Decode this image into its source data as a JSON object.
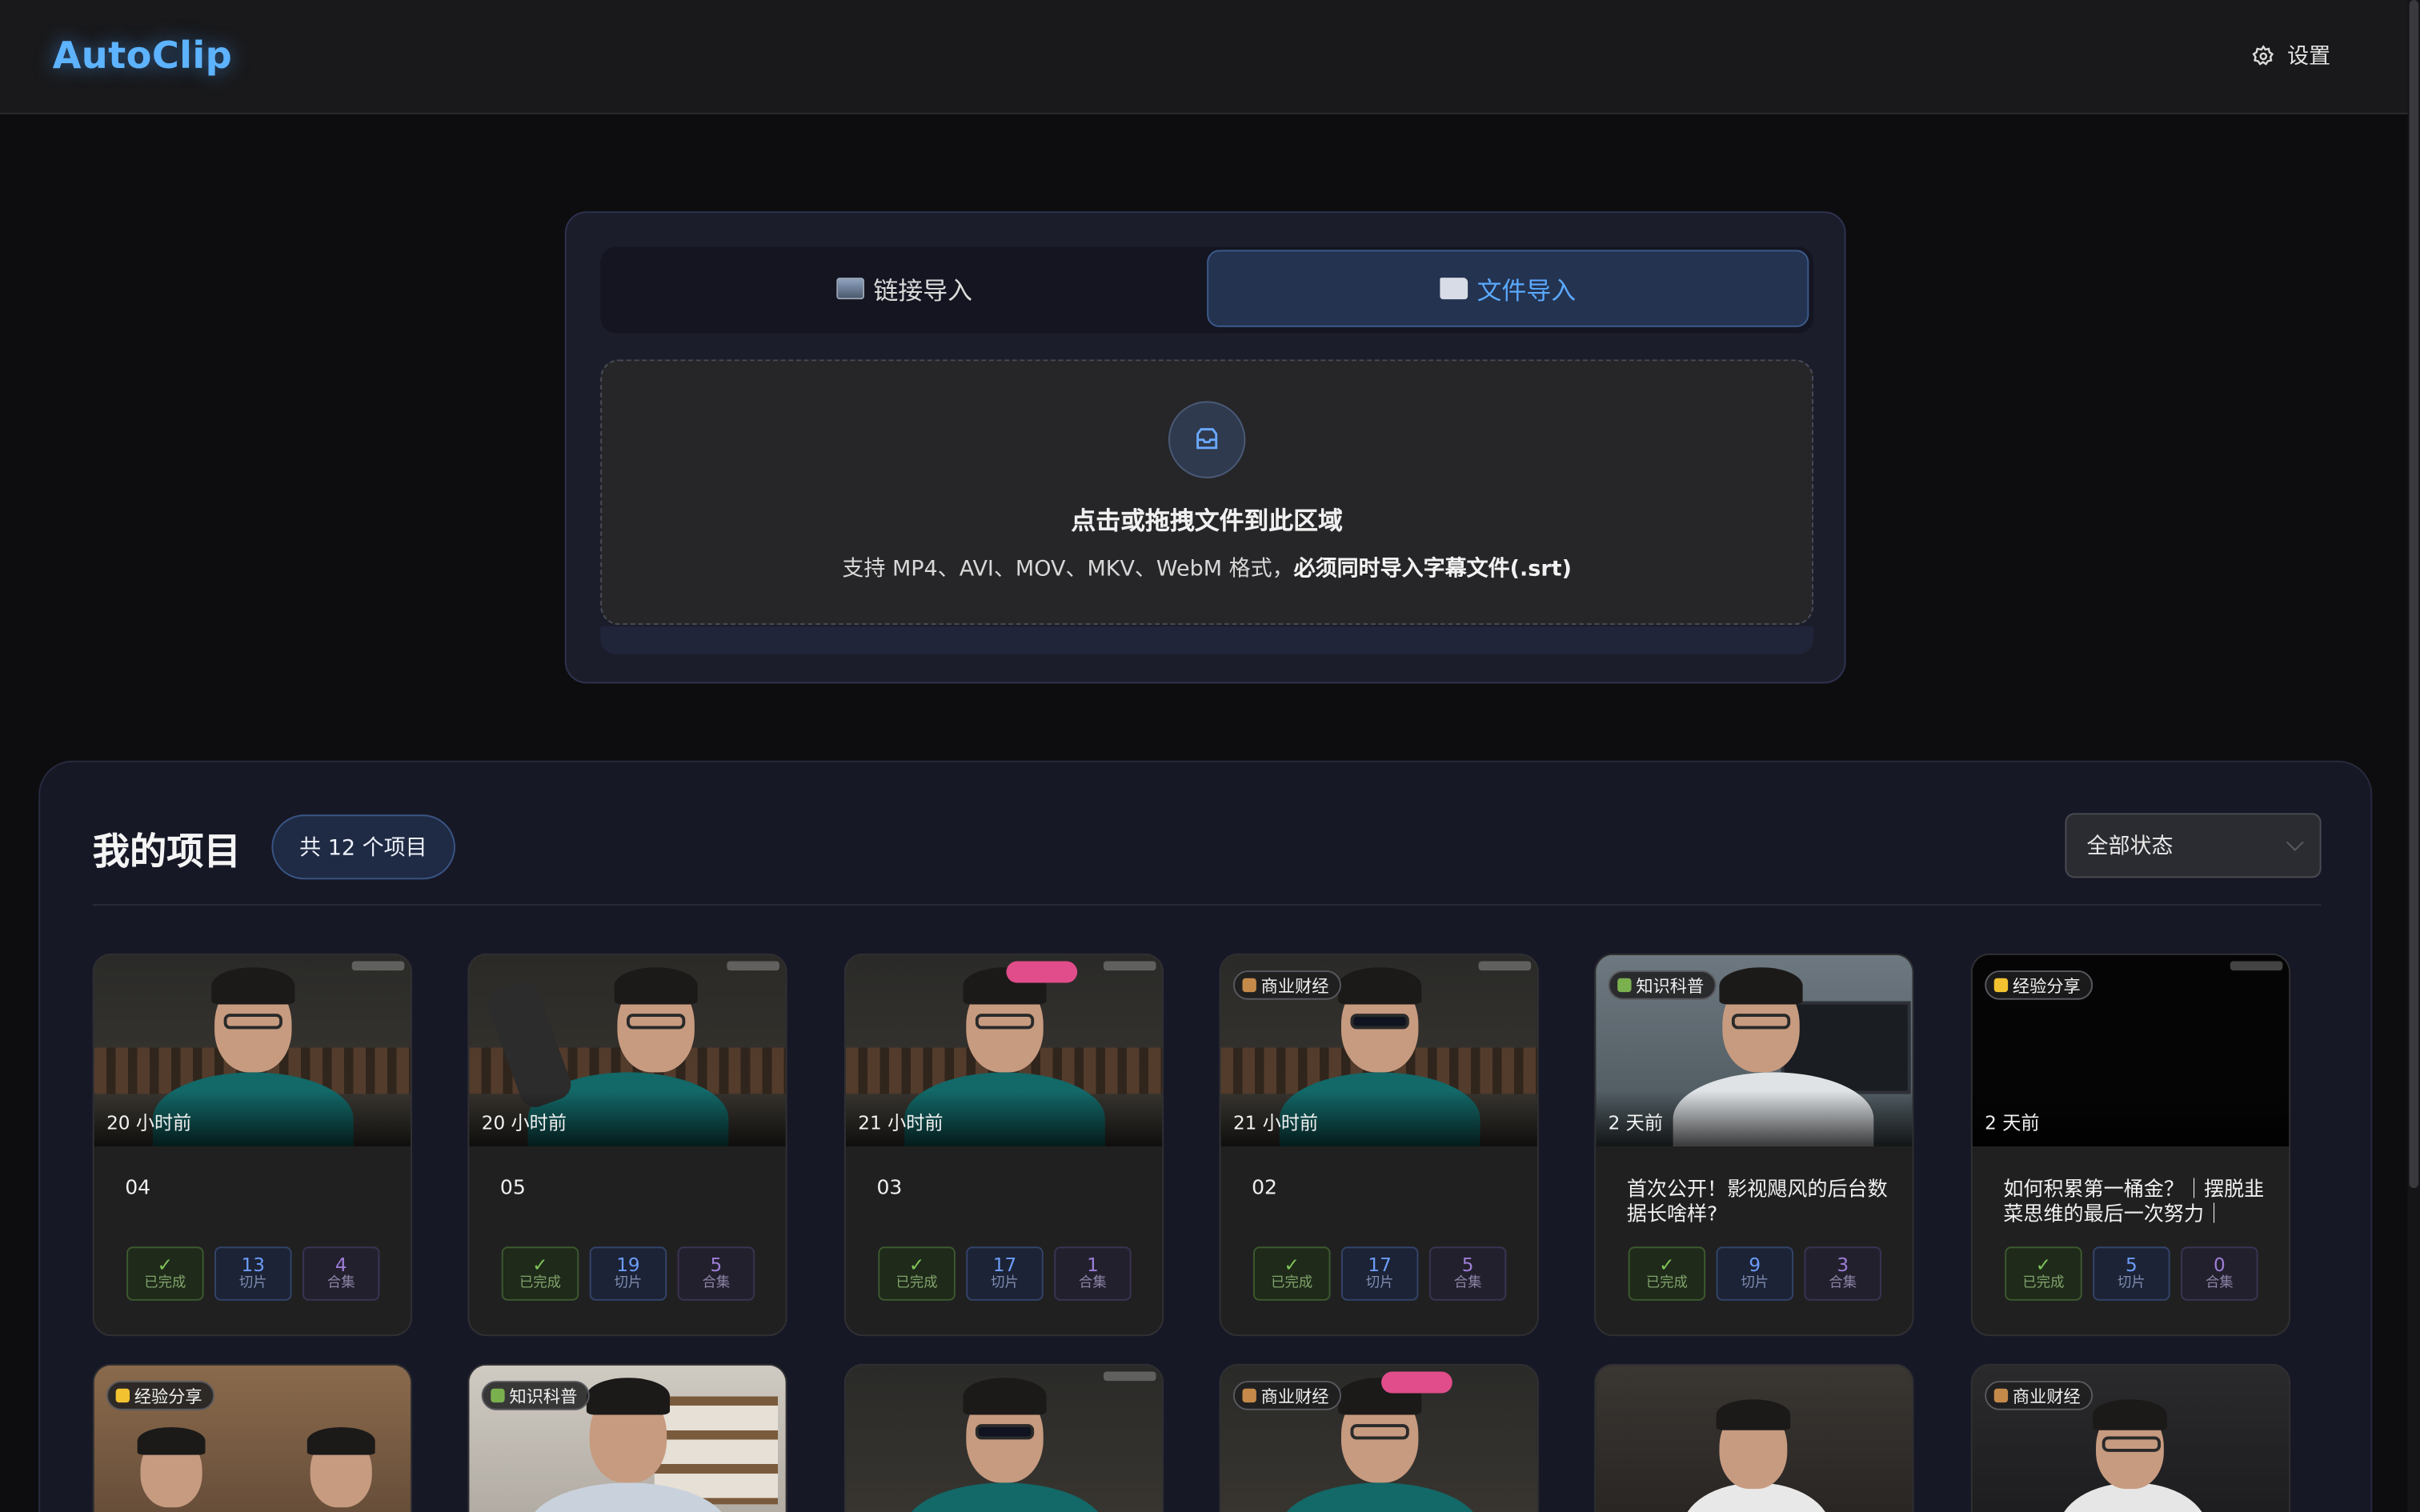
{
  "app": {
    "logo": "AutoClip",
    "settings_label": "设置"
  },
  "upload": {
    "tabs": [
      {
        "label": "链接导入",
        "icon": "television-icon"
      },
      {
        "label": "文件导入",
        "icon": "folder-icon",
        "active": true
      }
    ],
    "dropzone_title": "点击或拖拽文件到此区域",
    "dropzone_hint_prefix": "支持 MP4、AVI、MOV、MKV、WebM 格式，",
    "dropzone_hint_bold": "必须同时导入字幕文件(.srt)"
  },
  "projects": {
    "title": "我的项目",
    "count_badge": "共 12 个项目",
    "status_filter": "全部状态",
    "labels": {
      "done": "已完成",
      "clips": "切片",
      "collections": "合集",
      "check": "✓"
    },
    "cards": [
      {
        "time": "20 小时前",
        "title": "04",
        "clips": "13",
        "collections": "4",
        "tag": ""
      },
      {
        "time": "20 小时前",
        "title": "05",
        "clips": "19",
        "collections": "5",
        "tag": ""
      },
      {
        "time": "21 小时前",
        "title": "03",
        "clips": "17",
        "collections": "1",
        "tag": ""
      },
      {
        "time": "21 小时前",
        "title": "02",
        "clips": "17",
        "collections": "5",
        "tag": "商业财经"
      },
      {
        "time": "2 天前",
        "title": "首次公开！影视飓风的后台数据长啥样?",
        "clips": "9",
        "collections": "3",
        "tag": "知识科普"
      },
      {
        "time": "2 天前",
        "title": "如何积累第一桶金？｜摆脱韭菜思维的最后一次努力｜",
        "clips": "5",
        "collections": "0",
        "tag": "经验分享"
      }
    ],
    "bottom_cards": [
      {
        "tag": "经验分享"
      },
      {
        "tag": "知识科普"
      },
      {
        "tag": ""
      },
      {
        "tag": "商业财经"
      },
      {
        "tag": ""
      },
      {
        "tag": "商业财经"
      }
    ]
  },
  "colors": {
    "accent": "#5aa9ff",
    "done": "#7fc65a",
    "clips": "#6c9cf6",
    "collections": "#9d7ed6"
  }
}
